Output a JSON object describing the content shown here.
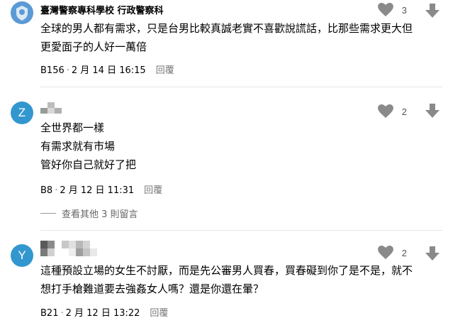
{
  "comments": [
    {
      "author": "臺灣警察專科學校 行政警察科",
      "lines": [
        "全球的男人都有需求，只是台男比較真誠老實不喜歡說謊話，比那些需求更大但",
        "更愛面子的人好一萬倍"
      ],
      "floor": "B156",
      "date": "2 月 14 日 16:15",
      "reply": "回覆",
      "likes": "3"
    },
    {
      "avatar_letter": "Z",
      "lines": [
        "全世界都一樣",
        "有需求就有市場",
        "管好你自己就好了把"
      ],
      "floor": "B8",
      "date": "2 月 12 日 11:31",
      "reply": "回覆",
      "likes": "2",
      "more_replies": "查看其他 3 則留言"
    },
    {
      "avatar_letter": "Y",
      "lines": [
        "這種預設立場的女生不討厭，而是先公審男人買春，買春礙到你了是不是，就不",
        "想打手槍難道要去強姦女人嗎？還是你還在暈？"
      ],
      "floor": "B21",
      "date": "2 月 12 日 13:22",
      "reply": "回覆",
      "likes": "2"
    }
  ],
  "colors": {
    "avatar": "#3397cf",
    "icon": "#8a8a8a",
    "divider": "#e6e6e6"
  },
  "icons": {
    "like": "heart-icon",
    "dislike": "arrow-down-icon"
  }
}
